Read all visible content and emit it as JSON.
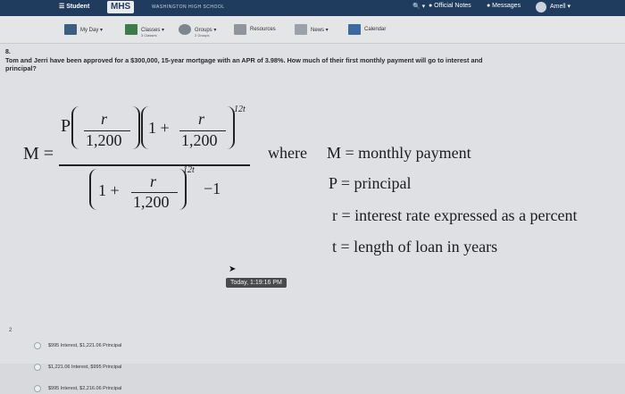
{
  "topbar": {
    "menu_label": "☰ Student",
    "logo": "MHS",
    "school_name": "WASHINGTON HIGH SCHOOL",
    "search_label": "🔍 ▾",
    "official_notes": "● Official Notes",
    "messages": "● Messages",
    "user_label": "Amell ▾"
  },
  "nav": {
    "my_day": "My Day ▾",
    "classes": "Classes ▾",
    "classes_sub": "3 Classes",
    "groups": "Groups ▾",
    "groups_sub": "2 Groups",
    "resources": "Resources",
    "news": "News ▾",
    "calendar": "Calendar"
  },
  "question": {
    "number": "8.",
    "text": "Tom and Jerri have been approved for a $300,000, 15-year mortgage with an APR of 3.98%. How much of their first monthly payment will go to interest and principal?",
    "item_number": "2"
  },
  "formula": {
    "M": "M =",
    "P": "P",
    "r": "r",
    "denom": "1,200",
    "one_plus": "1 +",
    "exp": "12t",
    "minus_one": "−1",
    "where": "where",
    "def_M": "M = monthly payment",
    "def_P": "P = principal",
    "def_r": "r = interest rate expressed as a percent",
    "def_t": "t = length of loan in years"
  },
  "tooltip": "Today, 1:19:16 PM",
  "choices": [
    {
      "label": "$995 Interest, $1,221.06 Principal"
    },
    {
      "label": "$1,221.06 Interest, $995 Principal"
    },
    {
      "label": "$995 Interest, $2,216.06 Principal"
    }
  ],
  "colors": {
    "header": "#1f3b5e",
    "tooltip": "#4a4a4a"
  }
}
